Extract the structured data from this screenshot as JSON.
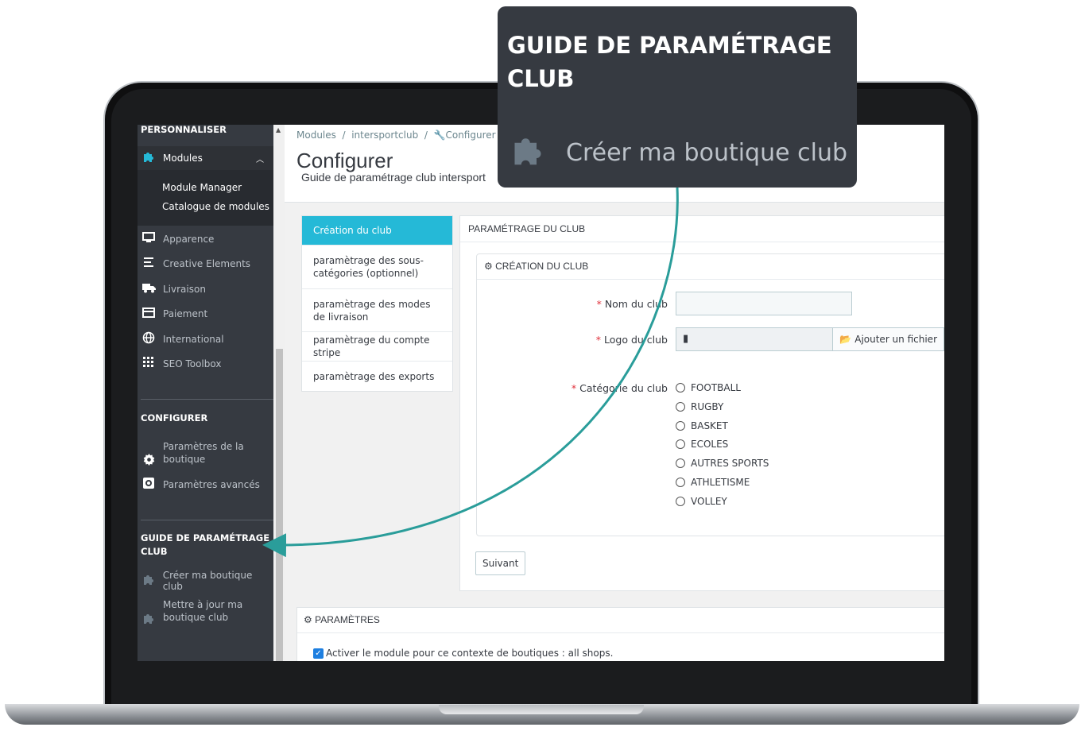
{
  "sidebar": {
    "personaliser": "PERSONNALISER",
    "modules": "Modules",
    "module_manager": "Module Manager",
    "catalogue": "Catalogue de modules",
    "items": [
      {
        "label": "Apparence",
        "icon": "monitor-icon"
      },
      {
        "label": "Creative Elements",
        "icon": "list-icon"
      },
      {
        "label": "Livraison",
        "icon": "truck-icon"
      },
      {
        "label": "Paiement",
        "icon": "card-icon"
      },
      {
        "label": "International",
        "icon": "globe-icon"
      },
      {
        "label": "SEO Toolbox",
        "icon": "grid-icon"
      }
    ],
    "configurer": "CONFIGURER",
    "params_boutique_1": "Paramètres de la",
    "params_boutique_2": "boutique",
    "params_avances": "Paramètres avancés",
    "guide_1": "GUIDE DE PARAMÉTRAGE",
    "guide_2": "CLUB",
    "creer": "Créer ma boutique club",
    "maj_1": "Mettre à jour ma",
    "maj_2": "boutique club"
  },
  "header": {
    "breadcrumb_1": "Modules",
    "breadcrumb_2": "intersportclub",
    "breadcrumb_3": "Configurer",
    "title": "Configurer",
    "subtitle": "Guide de paramétrage club intersport"
  },
  "tabs": [
    "Création du club",
    "paramètrage des sous-catégories (optionnel)",
    "paramètrage des modes de livraison",
    "paramètrage du compte stripe",
    "paramètrage des exports"
  ],
  "panel": {
    "title": "PARAMÉTRAGE DU CLUB",
    "section": "CRÉATION DU CLUB",
    "nom_label": "Nom du club",
    "logo_label": "Logo du club",
    "file_button": "Ajouter un fichier",
    "categorie_label": "Catégorie du club",
    "categories": [
      "FOOTBALL",
      "RUGBY",
      "BASKET",
      "ECOLES",
      "AUTRES SPORTS",
      "ATHLETISME",
      "VOLLEY"
    ],
    "next_button": "Suivant"
  },
  "params": {
    "title": "PARAMÈTRES",
    "checkbox_label": "Activer le module pour ce contexte de boutiques : all shops."
  },
  "callout": {
    "title": "GUIDE DE PARAMÉTRAGE CLUB",
    "item": "Créer ma boutique club"
  },
  "colors": {
    "accent": "#25b9d7",
    "sidebar": "#363a41",
    "arrow": "#2a9d9a"
  }
}
